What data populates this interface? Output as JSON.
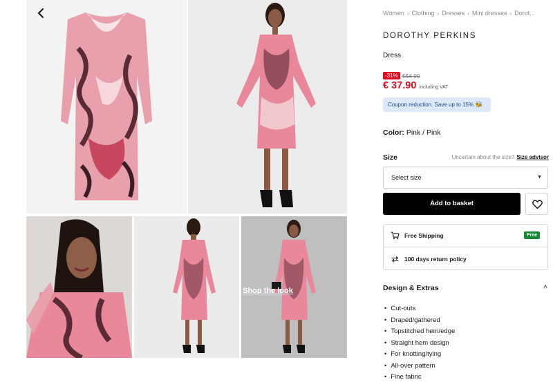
{
  "gallery": {
    "back_icon": "chevron-left-icon",
    "shop_the_look_label": "Shop the look"
  },
  "breadcrumb": [
    "Women",
    "Clothing",
    "Dresses",
    "Mini dresses",
    "Dorot..."
  ],
  "product": {
    "brand": "DOROTHY PERKINS",
    "name": "Dress",
    "discount": "-31%",
    "old_price": "€54.90",
    "price": "€ 37.90",
    "vat_note": "including VAT",
    "coupon_text": "Coupon reduction. Save up to 15%",
    "color_label": "Color:",
    "color_value": "Pink / Pink"
  },
  "size": {
    "title": "Size",
    "help_text": "Uncertain about the size?",
    "advisor_label": "Size advisor",
    "select_placeholder": "Select size"
  },
  "actions": {
    "basket_label": "Add to basket",
    "wishlist_icon": "heart-icon"
  },
  "info": {
    "shipping_label": "Free Shipping",
    "shipping_badge": "Free",
    "returns_label": "100 days return policy"
  },
  "design": {
    "title": "Design & Extras",
    "features": [
      "Cut-outs",
      "Draped/gathered",
      "Topstitched hem/edge",
      "Straight hem design",
      "For knotting/tying",
      "All-over pattern",
      "Fine fabric"
    ]
  },
  "colors": {
    "accent_red": "#e10a1f",
    "coupon_bg": "#dde9f7",
    "free_green": "#168838",
    "dress_pink": "#e8889a"
  }
}
